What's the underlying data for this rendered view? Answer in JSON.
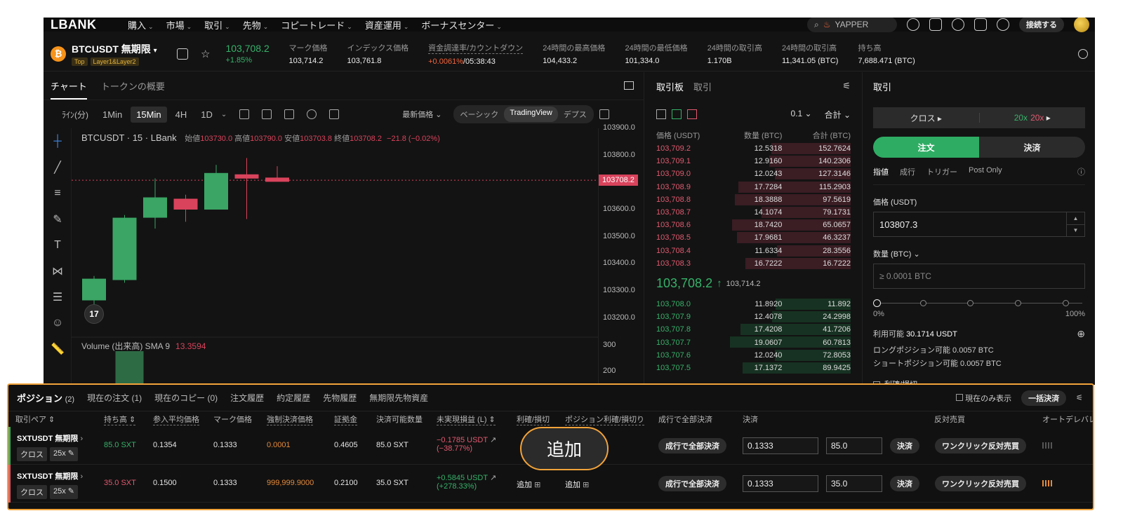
{
  "nav": {
    "logo": "LBANK",
    "items": [
      "購入",
      "市場",
      "取引",
      "先物",
      "コピートレード",
      "資産運用",
      "ボーナスセンター"
    ],
    "search": "YAPPER",
    "connect": "接続する"
  },
  "ticker": {
    "coin_letter": "₿",
    "pair": "BTCUSDT 無期限",
    "tag1": "Top",
    "tag2": "Layer1&Layer2",
    "price": "103,708.2",
    "change": "+1.85%",
    "stats": [
      {
        "label": "マーク価格",
        "value": "103,714.2"
      },
      {
        "label": "インデックス価格",
        "value": "103,761.8"
      },
      {
        "label": "資金調達率/カウントダウン",
        "value_pos": "+0.0061%",
        "value_rest": "/05:38:43"
      },
      {
        "label": "24時間の最高価格",
        "value": "104,433.2"
      },
      {
        "label": "24時間の最低価格",
        "value": "101,334.0"
      },
      {
        "label": "24時間の取引高",
        "value": "1.170B"
      },
      {
        "label": "24時間の取引高",
        "value": "11,341.05 (BTC)"
      },
      {
        "label": "持ち高",
        "value": "7,688.471 (BTC)"
      }
    ]
  },
  "chart": {
    "tab_active": "チャート",
    "tab_other": "トークンの概要",
    "timeframes": [
      "ﾗｲﾝ(分)",
      "1Min",
      "15Min",
      "4H",
      "1D"
    ],
    "selected_tf": "15Min",
    "latest_price": "最新価格",
    "views": [
      "ベーシック",
      "TradingView",
      "デプス"
    ],
    "legend_title": "BTCUSDT · 15 · LBank",
    "ohlc": {
      "o_label": "始値",
      "o": "103730.0",
      "h_label": "高値",
      "h": "103790.0",
      "l_label": "安値",
      "l": "103703.8",
      "c_label": "終値",
      "c": "103708.2",
      "chg": "−21.8 (−0.02%)"
    },
    "volume_label": "Volume (出来高) SMA 9",
    "volume_value": "13.3594",
    "current_price_tag": "103708.2",
    "tv_logo": "17"
  },
  "chart_data": {
    "type": "candlestick",
    "title": "BTCUSDT · 15 · LBank",
    "ylim": [
      103150,
      103900
    ],
    "y_ticks": [
      "103900.0",
      "103800.0",
      "103700.0",
      "103600.0",
      "103500.0",
      "103400.0",
      "103300.0",
      "103200.0"
    ],
    "y_tick_values": [
      103900,
      103800,
      103700,
      103600,
      103500,
      103400,
      103300,
      103200
    ],
    "volume_ticks": [
      "300",
      "200"
    ],
    "candles": [
      {
        "o": 103265,
        "h": 103355,
        "l": 103230,
        "c": 103345
      },
      {
        "o": 103340,
        "h": 103580,
        "l": 103330,
        "c": 103570
      },
      {
        "o": 103570,
        "h": 103715,
        "l": 103530,
        "c": 103645
      },
      {
        "o": 103640,
        "h": 103655,
        "l": 103555,
        "c": 103600
      },
      {
        "o": 103600,
        "h": 103765,
        "l": 103600,
        "c": 103735
      },
      {
        "o": 103730,
        "h": 103790,
        "l": 103565,
        "c": 103718
      },
      {
        "o": 103718,
        "h": 103760,
        "l": 103703.8,
        "c": 103708.2
      }
    ]
  },
  "orderbook": {
    "tab_active": "取引板",
    "tab_other": "取引",
    "step": "0.1",
    "mode": "合計",
    "headers": [
      "価格 (USDT)",
      "数量 (BTC)",
      "合計 (BTC)"
    ],
    "asks": [
      [
        "103,709.2",
        "12.5318",
        "152.7624"
      ],
      [
        "103,709.1",
        "12.9160",
        "140.2306"
      ],
      [
        "103,709.0",
        "12.0243",
        "127.3146"
      ],
      [
        "103,708.9",
        "17.7284",
        "115.2903"
      ],
      [
        "103,708.8",
        "18.3888",
        "97.5619"
      ],
      [
        "103,708.7",
        "14.1074",
        "79.1731"
      ],
      [
        "103,708.6",
        "18.7420",
        "65.0657"
      ],
      [
        "103,708.5",
        "17.9681",
        "46.3237"
      ],
      [
        "103,708.4",
        "11.6334",
        "28.3556"
      ],
      [
        "103,708.3",
        "16.7222",
        "16.7222"
      ]
    ],
    "mid_price": "103,708.2",
    "mid_mark": "103,714.2",
    "bids": [
      [
        "103,708.0",
        "11.8920",
        "11.892"
      ],
      [
        "103,707.9",
        "12.4078",
        "24.2998"
      ],
      [
        "103,707.8",
        "17.4208",
        "41.7206"
      ],
      [
        "103,707.7",
        "19.0607",
        "60.7813"
      ],
      [
        "103,707.6",
        "12.0240",
        "72.8053"
      ],
      [
        "103,707.5",
        "17.1372",
        "89.9425"
      ]
    ]
  },
  "trade": {
    "title": "取引",
    "margin_mode": "クロス",
    "lev_long": "20x",
    "lev_short": "20x",
    "btn_open": "注文",
    "btn_close": "決済",
    "order_types": [
      "指値",
      "成行",
      "トリガー",
      "Post Only"
    ],
    "price_label": "価格 (USDT)",
    "price_value": "103807.3",
    "qty_label": "数量 (BTC)",
    "qty_placeholder": "≥ 0.0001 BTC",
    "pct_min": "0%",
    "pct_max": "100%",
    "avail_label": "利用可能",
    "avail_value": "30.1714 USDT",
    "long_avail": "ロングポジション可能 0.0057 BTC",
    "short_avail": "ショートポジション可能 0.0057 BTC",
    "tpsl": "利確/損切"
  },
  "positions": {
    "tabs": [
      {
        "label": "ポジション",
        "count": "(2)"
      },
      {
        "label": "現在の注文",
        "count": "(1)"
      },
      {
        "label": "現在のコピー",
        "count": "(0)"
      },
      {
        "label": "注文履歴",
        "count": ""
      },
      {
        "label": "約定履歴",
        "count": ""
      },
      {
        "label": "先物履歴",
        "count": ""
      },
      {
        "label": "無期限先物資産",
        "count": ""
      }
    ],
    "show_current": "現在のみ表示",
    "bulk_close": "一括決済",
    "headers": [
      "取引ペア ⇕",
      "持ち高 ⇕",
      "参入平均価格",
      "マーク価格",
      "強制決済価格",
      "証拠金",
      "決済可能数量",
      "未実現損益 (L) ⇕",
      "利確/損切",
      "ポジション利確/損切り",
      "成行で全部決済",
      "決済",
      "反対売買",
      "オートデレバレ"
    ],
    "rows": [
      {
        "pair": "SXTUSDT 無期限",
        "mode": "クロス",
        "lev": "25x",
        "size": "85.0 SXT",
        "entry": "0.1354",
        "mark": "0.1333",
        "liq": "0.0001",
        "margin": "0.4605",
        "closable": "85.0 SXT",
        "pnl": "−0.1785 USDT",
        "pnl_pct": "(−38.77%)",
        "tpsl": "",
        "pos_tpsl": "",
        "market_close": "成行で全部決済",
        "close_price": "0.1333",
        "close_qty": "85.0",
        "close_btn": "決済",
        "reverse": "ワンクリック反対売買",
        "side": "long"
      },
      {
        "pair": "SXTUSDT 無期限",
        "mode": "クロス",
        "lev": "25x",
        "size": "35.0 SXT",
        "entry": "0.1500",
        "mark": "0.1333",
        "liq": "999,999.9000",
        "margin": "0.2100",
        "closable": "35.0 SXT",
        "pnl": "+0.5845 USDT",
        "pnl_pct": "(+278.33%)",
        "tpsl": "追加",
        "pos_tpsl": "追加",
        "market_close": "成行で全部決済",
        "close_price": "0.1333",
        "close_qty": "35.0",
        "close_btn": "決済",
        "reverse": "ワンクリック反対売買",
        "side": "short"
      }
    ],
    "callout": "追加"
  }
}
